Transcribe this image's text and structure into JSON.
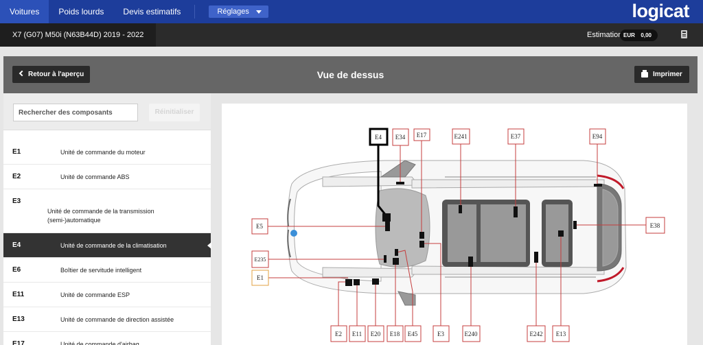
{
  "top_nav": {
    "tabs": [
      "Voitures",
      "Poids lourds",
      "Devis estimatifs"
    ],
    "settings_label": "Réglages",
    "logo_text": "logicat"
  },
  "vehicle_bar": {
    "vehicle": "X7 (G07) M50i (N63B44D) 2019 - 2022",
    "estimation_label": "Estimation",
    "currency": "EUR",
    "amount": "0,00"
  },
  "header": {
    "back_label": "Retour à l'aperçu",
    "title": "Vue de dessus",
    "print_label": "Imprimer"
  },
  "sidebar": {
    "search_placeholder": "Rechercher des composants",
    "reset_label": "Réinitialiser",
    "items": [
      {
        "code": "E1",
        "label": "Unité de commande du moteur"
      },
      {
        "code": "E2",
        "label": "Unité de commande ABS"
      },
      {
        "code": "E3",
        "label": "Unité de commande de la transmission (semi-)automatique"
      },
      {
        "code": "E4",
        "label": "Unité de commande de la climatisation"
      },
      {
        "code": "E6",
        "label": "Boîtier de servitude intelligent"
      },
      {
        "code": "E11",
        "label": "Unité de commande ESP"
      },
      {
        "code": "E13",
        "label": "Unité de commande de direction assistée"
      },
      {
        "code": "E17",
        "label": "Unité de commande d'airbag"
      }
    ],
    "active_index": 3
  },
  "diagram": {
    "labels": [
      "E4",
      "E34",
      "E17",
      "E241",
      "E37",
      "E94",
      "E5",
      "E38",
      "E235",
      "E1",
      "E2",
      "E11",
      "E20",
      "E18",
      "E45",
      "E3",
      "E240",
      "E242",
      "E13"
    ],
    "colors": {
      "label_border": "#c43c3c",
      "highlight": "#000000",
      "marker_e1": "#e0a040",
      "accent_blue": "#3b8fd8",
      "taillight": "#c01a2a"
    }
  }
}
